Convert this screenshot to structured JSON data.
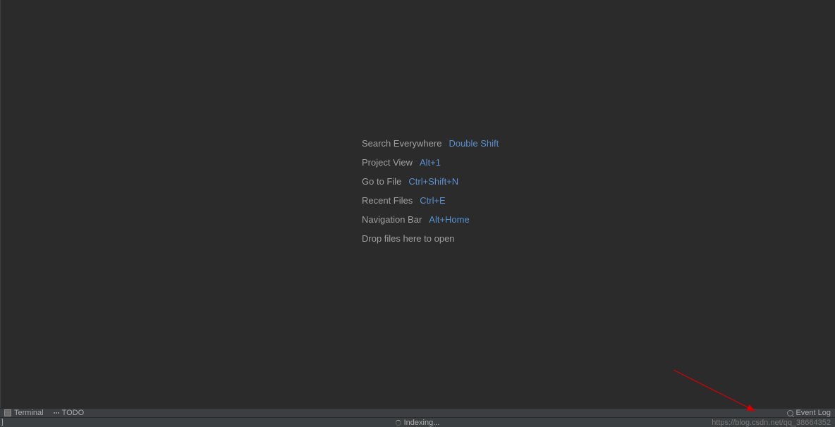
{
  "hints": [
    {
      "label": "Search Everywhere",
      "shortcut": "Double Shift"
    },
    {
      "label": "Project View",
      "shortcut": "Alt+1"
    },
    {
      "label": "Go to File",
      "shortcut": "Ctrl+Shift+N"
    },
    {
      "label": "Recent Files",
      "shortcut": "Ctrl+E"
    },
    {
      "label": "Navigation Bar",
      "shortcut": "Alt+Home"
    },
    {
      "label": "Drop files here to open",
      "shortcut": ""
    }
  ],
  "toolbar": {
    "terminal": "Terminal",
    "todo": "TODO",
    "event_log": "Event Log"
  },
  "status": {
    "left": "]",
    "center": "Indexing...",
    "right": "https://blog.csdn.net/qq_38664352"
  }
}
